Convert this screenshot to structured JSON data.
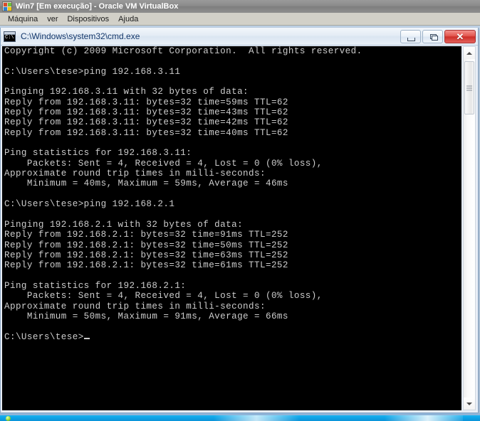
{
  "vbox": {
    "title": "Win7 [Em execução] - Oracle VM VirtualBox",
    "icon": "windows-logo-icon",
    "menu": [
      {
        "label": "Máquina"
      },
      {
        "label": "ver"
      },
      {
        "label": "Dispositivos"
      },
      {
        "label": "Ajuda"
      }
    ]
  },
  "cmd": {
    "title": "C:\\Windows\\system32\\cmd.exe",
    "icon_text": "C:\\",
    "buttons": {
      "minimize": "minimize-icon",
      "restore": "restore-icon",
      "close": "✕"
    },
    "console_text": "Copyright (c) 2009 Microsoft Corporation.  All rights reserved.\n\nC:\\Users\\tese>ping 192.168.3.11\n\nPinging 192.168.3.11 with 32 bytes of data:\nReply from 192.168.3.11: bytes=32 time=59ms TTL=62\nReply from 192.168.3.11: bytes=32 time=43ms TTL=62\nReply from 192.168.3.11: bytes=32 time=42ms TTL=62\nReply from 192.168.3.11: bytes=32 time=40ms TTL=62\n\nPing statistics for 192.168.3.11:\n    Packets: Sent = 4, Received = 4, Lost = 0 (0% loss),\nApproximate round trip times in milli-seconds:\n    Minimum = 40ms, Maximum = 59ms, Average = 46ms\n\nC:\\Users\\tese>ping 192.168.2.1\n\nPinging 192.168.2.1 with 32 bytes of data:\nReply from 192.168.2.1: bytes=32 time=91ms TTL=252\nReply from 192.168.2.1: bytes=32 time=50ms TTL=252\nReply from 192.168.2.1: bytes=32 time=63ms TTL=252\nReply from 192.168.2.1: bytes=32 time=61ms TTL=252\n\nPing statistics for 192.168.2.1:\n    Packets: Sent = 4, Received = 4, Lost = 0 (0% loss),\nApproximate round trip times in milli-seconds:\n    Minimum = 50ms, Maximum = 91ms, Average = 66ms\n\nC:\\Users\\tese>",
    "scrollbar": {
      "up_arrow": "scroll-up-icon",
      "down_arrow": "scroll-down-icon"
    }
  },
  "guest_taskbar": {
    "start_orb": "start-orb-icon"
  },
  "colors": {
    "vbox_title_bg": "#8a8a8a",
    "vbox_menu_bg": "#d2d0c8",
    "cmd_title_text": "#14386b",
    "console_bg": "#000000",
    "console_fg": "#cccccc",
    "close_button": "#cd2e28",
    "taskbar": "#0fa6e8",
    "desktop": "#c3d6ea"
  }
}
